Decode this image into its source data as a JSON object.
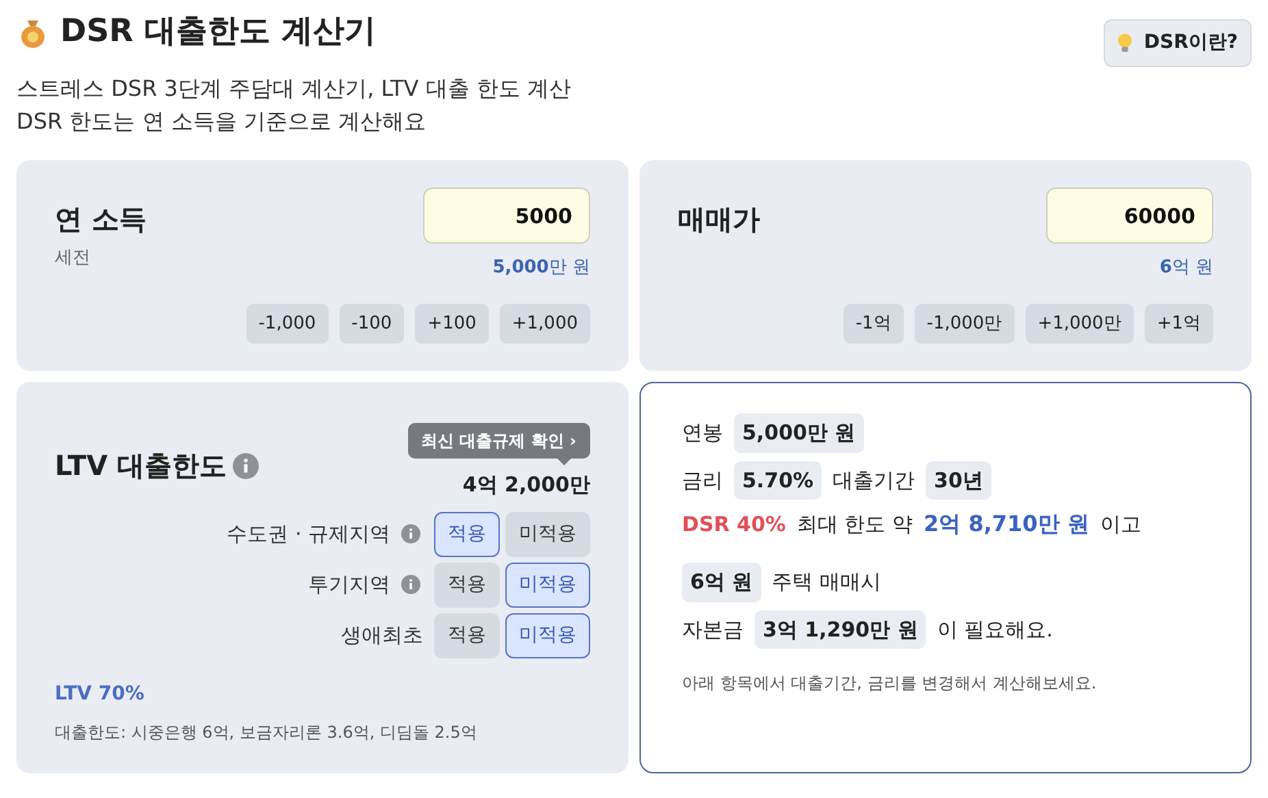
{
  "header": {
    "title": "DSR 대출한도 계산기",
    "help_button": "DSR이란?"
  },
  "subtitle_lines": [
    "스트레스 DSR 3단계 주담대 계산기, LTV 대출 한도 계산",
    "DSR 한도는 연 소득을 기준으로 계산해요"
  ],
  "inputs": [
    {
      "label": "연 소득",
      "sublabel": "세전",
      "value": "5000",
      "formatted": "**5,000**만 원",
      "steps": [
        "-1,000",
        "-100",
        "+100",
        "+1,000"
      ]
    },
    {
      "label": "매매가",
      "value": "60000",
      "formatted": "**6**억 원",
      "steps": [
        "-1억",
        "-1,000만",
        "+1,000만",
        "+1억"
      ]
    }
  ],
  "ltv": {
    "title": "LTV 대출한도",
    "tooltip": "최신 대출규제 확인 ›",
    "amount": "4억 2,000만",
    "conditions": [
      {
        "label": "수도권 · 규제지역",
        "info": true,
        "options": [
          {
            "label": "적용",
            "selected": true
          },
          {
            "label": "미적용",
            "selected": false
          }
        ]
      },
      {
        "label": "투기지역",
        "info": true,
        "options": [
          {
            "label": "적용",
            "selected": false
          },
          {
            "label": "미적용",
            "selected": true
          }
        ]
      },
      {
        "label": "생애최초",
        "info": false,
        "options": [
          {
            "label": "적용",
            "selected": false
          },
          {
            "label": "미적용",
            "selected": true
          }
        ]
      }
    ],
    "ratio": "LTV 70%",
    "note": "대출한도: 시중은행 6억, 보금자리론 3.6억, 디딤돌 2.5억"
  },
  "result": {
    "lines": [
      [
        {
          "kind": "text",
          "text": "연봉"
        },
        {
          "kind": "chip",
          "text": "5,000만 원"
        }
      ],
      [
        {
          "kind": "text",
          "text": "금리"
        },
        {
          "kind": "chip",
          "text": "5.70%"
        },
        {
          "kind": "text",
          "text": "대출기간"
        },
        {
          "kind": "chip",
          "text": "30년"
        }
      ],
      [
        {
          "kind": "danger",
          "text": "DSR 40%"
        },
        {
          "kind": "text",
          "text": "최대 한도 약"
        },
        {
          "kind": "accent",
          "text": "2억 8,710만 원"
        },
        {
          "kind": "text",
          "text": "이고"
        }
      ],
      [
        {
          "kind": "chip",
          "text": "6억 원"
        },
        {
          "kind": "text",
          "text": "주택 매매시"
        }
      ],
      [
        {
          "kind": "text",
          "text": "자본금"
        },
        {
          "kind": "chip",
          "text": "3억 1,290만 원"
        },
        {
          "kind": "text",
          "text": "이 필요해요."
        }
      ]
    ],
    "note": "아래 항목에서 대출기간, 금리를 변경해서 계산해보세요."
  }
}
